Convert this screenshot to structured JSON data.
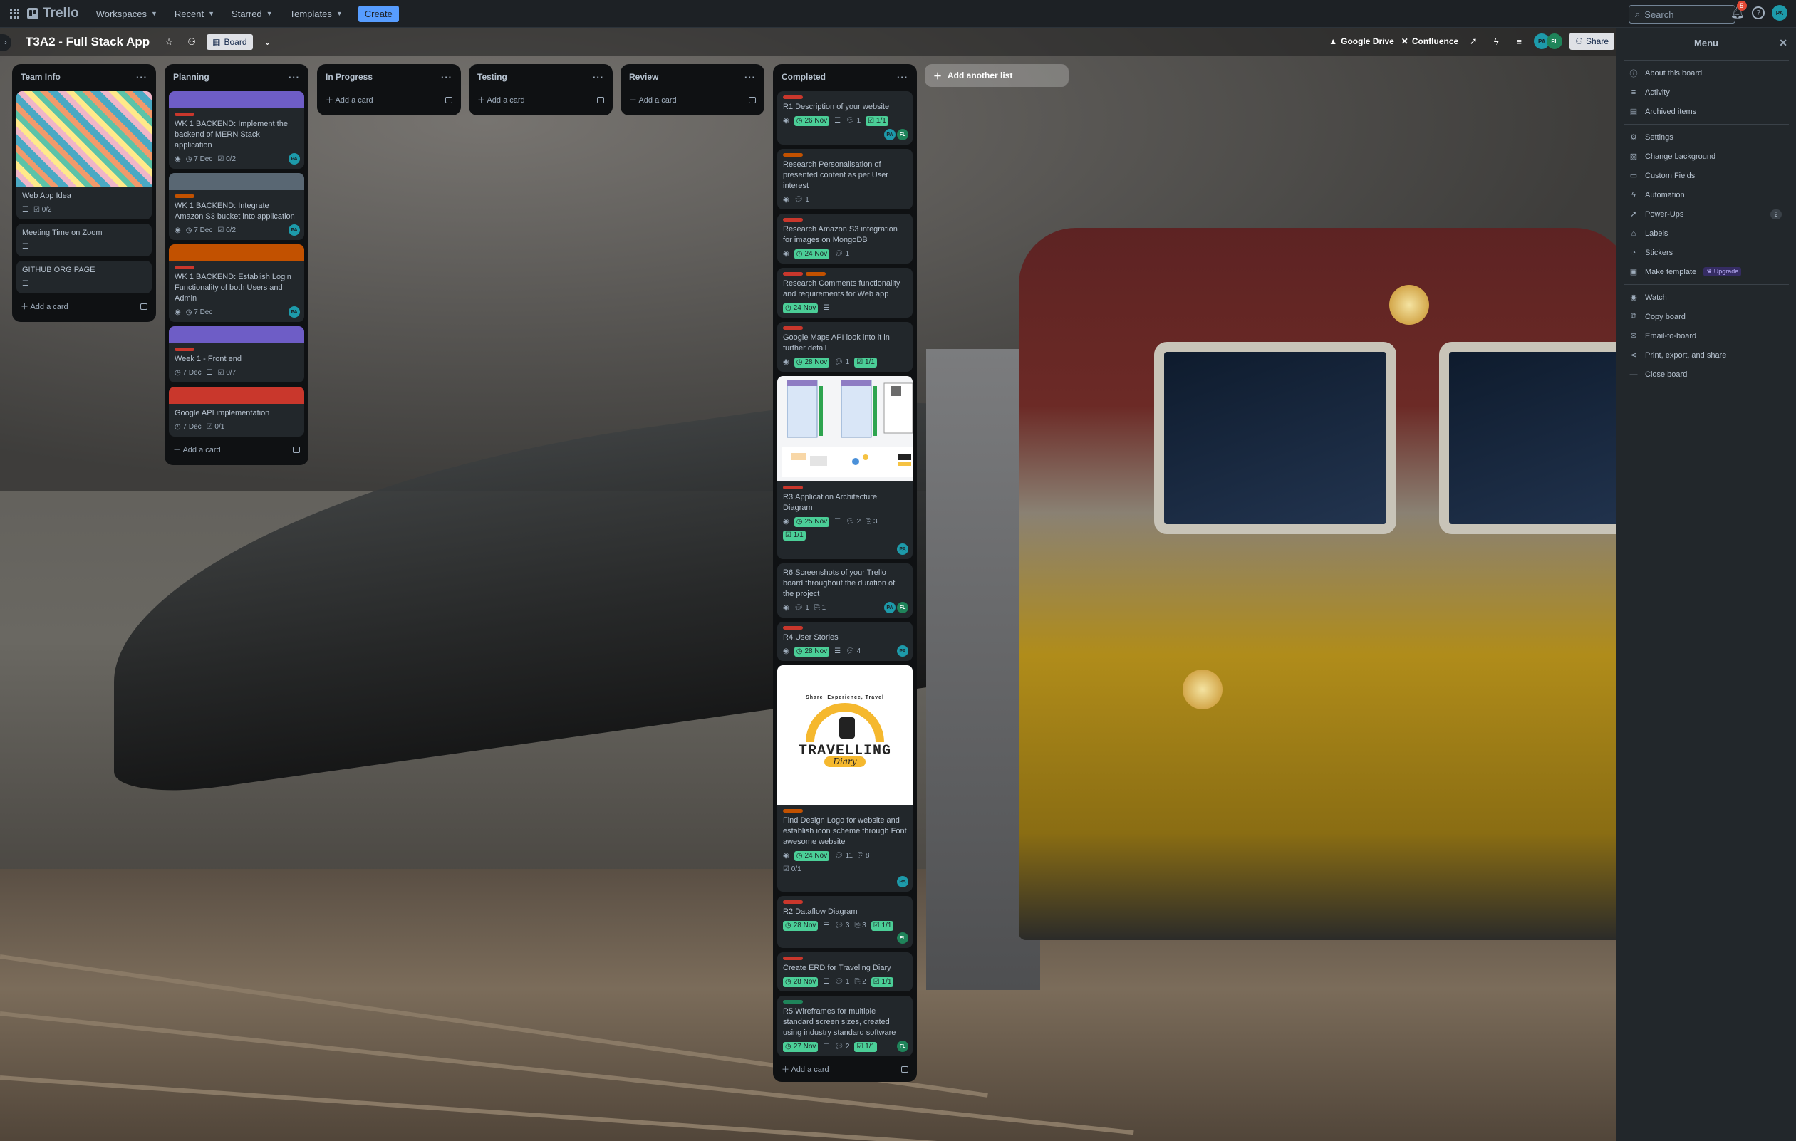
{
  "topbar": {
    "app_name": "Trello",
    "nav": [
      {
        "label": "Workspaces"
      },
      {
        "label": "Recent"
      },
      {
        "label": "Starred"
      },
      {
        "label": "Templates"
      }
    ],
    "create_label": "Create",
    "search_placeholder": "Search",
    "notification_count": "5"
  },
  "board": {
    "title": "T3A2 - Full Stack App",
    "view_label": "Board",
    "power_ups": [
      {
        "label": "Google Drive"
      },
      {
        "label": "Confluence"
      }
    ],
    "share_label": "Share",
    "add_list_label": "Add another list"
  },
  "lists": [
    {
      "title": "Team Info",
      "add_label": "Add a card",
      "cards": [
        {
          "title": "Web App Idea",
          "checklist": "0/2"
        },
        {
          "title": "Meeting Time on Zoom"
        },
        {
          "title": "GITHUB ORG PAGE"
        }
      ]
    },
    {
      "title": "Planning",
      "add_label": "Add a card",
      "cards": [
        {
          "title": "WK 1 BACKEND: Implement the backend of MERN Stack application",
          "due": "7 Dec",
          "checklist": "0/2"
        },
        {
          "title": "WK 1 BACKEND: Integrate Amazon S3 bucket into application",
          "due": "7 Dec",
          "checklist": "0/2"
        },
        {
          "title": "WK 1 BACKEND: Establish Login Functionality of both Users and Admin",
          "due": "7 Dec"
        },
        {
          "title": "Week 1 - Front end",
          "due": "7 Dec",
          "checklist": "0/7"
        },
        {
          "title": "Google API implementation",
          "due": "7 Dec",
          "checklist": "0/1"
        }
      ]
    },
    {
      "title": "In Progress",
      "add_label": "Add a card",
      "cards": []
    },
    {
      "title": "Testing",
      "add_label": "Add a card",
      "cards": []
    },
    {
      "title": "Review",
      "add_label": "Add a card",
      "cards": []
    },
    {
      "title": "Completed",
      "add_label": "Add a card",
      "cards": [
        {
          "title": "R1.Description of your website",
          "due": "26 Nov",
          "comments": "1",
          "checklist": "1/1"
        },
        {
          "title": "Research Personalisation of presented content as per User interest",
          "comments": "1"
        },
        {
          "title": "Research Amazon S3 integration for images on MongoDB",
          "due": "24 Nov",
          "comments": "1"
        },
        {
          "title": "Research Comments functionality and requirements for Web app",
          "due": "24 Nov"
        },
        {
          "title": "Google Maps API look into it in further detail",
          "due": "28 Nov",
          "comments": "1",
          "checklist": "1/1"
        },
        {
          "title": "R3.Application Architecture Diagram",
          "due": "25 Nov",
          "comments": "2",
          "attachments": "3",
          "checklist": "1/1"
        },
        {
          "title": "R6.Screenshots of your Trello board throughout the duration of the project",
          "comments": "1",
          "attachments": "1"
        },
        {
          "title": "R4.User Stories",
          "due": "28 Nov",
          "comments": "4"
        },
        {
          "title": "Find Design Logo for website and establish icon scheme through Font awesome website",
          "due": "24 Nov",
          "comments": "11",
          "attachments": "8",
          "checklist": "0/1"
        },
        {
          "title": "R2.Dataflow Diagram",
          "due": "28 Nov",
          "comments": "3",
          "attachments": "3",
          "checklist": "1/1"
        },
        {
          "title": "Create ERD for Traveling Diary",
          "due": "28 Nov",
          "comments": "1",
          "attachments": "2",
          "checklist": "1/1"
        },
        {
          "title": "R5.Wireframes for multiple standard screen sizes, created using industry standard software",
          "due": "27 Nov",
          "comments": "2",
          "checklist": "1/1"
        }
      ]
    }
  ],
  "logo_card": {
    "arc_text": "Share, Experience, Travel",
    "word": "TRAVELLING",
    "script": "Diary"
  },
  "avatars": {
    "pa": "PA",
    "fl": "FL"
  },
  "menu": {
    "title": "Menu",
    "items": [
      {
        "label": "About this board"
      },
      {
        "label": "Activity"
      },
      {
        "label": "Archived items"
      },
      {
        "label": "Settings"
      },
      {
        "label": "Change background"
      },
      {
        "label": "Custom Fields"
      },
      {
        "label": "Automation"
      },
      {
        "label": "Power-Ups",
        "count": "2"
      },
      {
        "label": "Labels"
      },
      {
        "label": "Stickers"
      },
      {
        "label": "Make template",
        "badge": "Upgrade"
      },
      {
        "label": "Watch"
      },
      {
        "label": "Copy board"
      },
      {
        "label": "Email-to-board"
      },
      {
        "label": "Print, export, and share"
      },
      {
        "label": "Close board"
      }
    ]
  },
  "colors": {
    "accent": "#579dff",
    "label_red": "#c9372c",
    "label_orange": "#c25100",
    "label_green": "#4bce97",
    "cover_purple": "#6e5dc6",
    "cover_gray": "#596773",
    "cover_orange": "#c25100",
    "cover_red": "#c9372c",
    "avatar_teal": "#1d9aaa",
    "avatar_green": "#1f845a"
  }
}
